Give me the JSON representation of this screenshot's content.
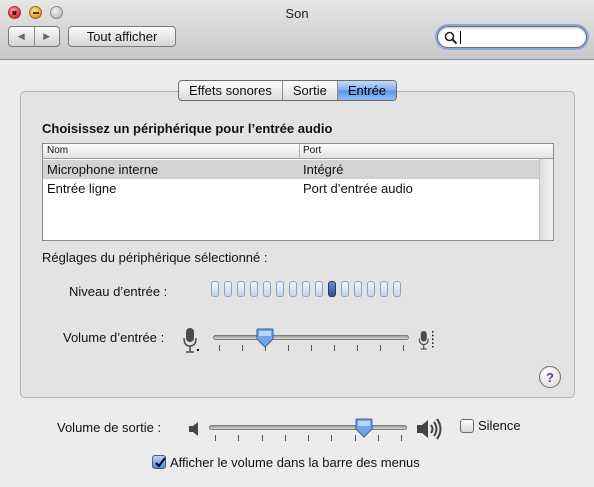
{
  "window": {
    "title": "Son"
  },
  "toolbar": {
    "show_all_label": "Tout afficher",
    "search_value": ""
  },
  "tabs": [
    {
      "label": "Effets sonores",
      "active": false
    },
    {
      "label": "Sortie",
      "active": false
    },
    {
      "label": "Entrée",
      "active": true
    }
  ],
  "input_panel": {
    "heading": "Choisissez un périphérique pour l’entrée audio",
    "columns": [
      "Nom",
      "Port"
    ],
    "devices": [
      {
        "name": "Microphone interne",
        "port": "Intégré",
        "selected": true
      },
      {
        "name": "Entrée ligne",
        "port": "Port d’entrée audio",
        "selected": false
      }
    ],
    "settings_heading": "Réglages du périphérique sélectionné :",
    "input_level_label": "Niveau d’entrée :",
    "input_level": {
      "segments": 15,
      "active_segment": 9
    },
    "input_volume_label": "Volume d’entrée :",
    "input_volume": 0.25
  },
  "output": {
    "volume_label": "Volume de sortie :",
    "volume": 0.8,
    "mute_label": "Silence",
    "mute_checked": false,
    "menu_bar_label": "Afficher le volume dans la barre des menus",
    "menu_bar_checked": true
  },
  "colors": {
    "selection_blue": "#5996e6",
    "level_active": "#274f94",
    "help_purple": "#6a32a5"
  },
  "icons": {
    "help": "?",
    "nav_back": "◀",
    "nav_forward": "▶"
  }
}
